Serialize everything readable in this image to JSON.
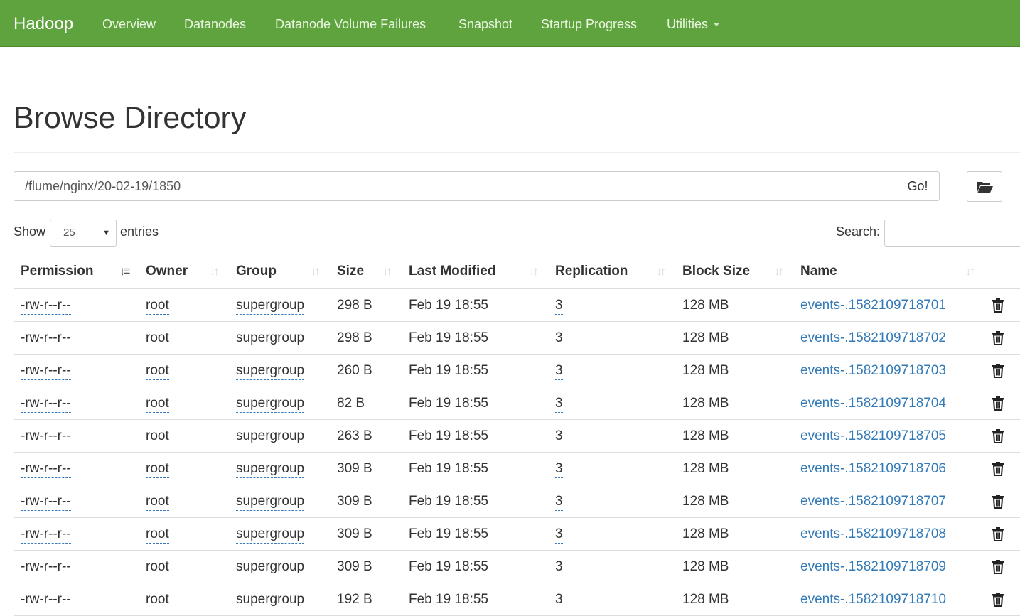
{
  "navbar": {
    "brand": "Hadoop",
    "items": [
      "Overview",
      "Datanodes",
      "Datanode Volume Failures",
      "Snapshot",
      "Startup Progress",
      "Utilities"
    ],
    "color": "#5fa33e"
  },
  "page": {
    "title": "Browse Directory"
  },
  "path_bar": {
    "value": "/flume/nginx/20-02-19/1850",
    "go_label": "Go!",
    "folder_icon": "folder-open-icon"
  },
  "controls": {
    "show_label": "Show",
    "page_length": "25",
    "entries_label": "entries",
    "search_label": "Search:",
    "search_value": ""
  },
  "table": {
    "columns": [
      "Permission",
      "Owner",
      "Group",
      "Size",
      "Last Modified",
      "Replication",
      "Block Size",
      "Name"
    ],
    "sorted_column": "Permission",
    "rows": [
      {
        "permission": "-rw-r--r--",
        "owner": "root",
        "group": "supergroup",
        "size": "298 B",
        "modified": "Feb 19 18:55",
        "replication": "3",
        "block_size": "128 MB",
        "name": "events-.1582109718701"
      },
      {
        "permission": "-rw-r--r--",
        "owner": "root",
        "group": "supergroup",
        "size": "298 B",
        "modified": "Feb 19 18:55",
        "replication": "3",
        "block_size": "128 MB",
        "name": "events-.1582109718702"
      },
      {
        "permission": "-rw-r--r--",
        "owner": "root",
        "group": "supergroup",
        "size": "260 B",
        "modified": "Feb 19 18:55",
        "replication": "3",
        "block_size": "128 MB",
        "name": "events-.1582109718703"
      },
      {
        "permission": "-rw-r--r--",
        "owner": "root",
        "group": "supergroup",
        "size": "82 B",
        "modified": "Feb 19 18:55",
        "replication": "3",
        "block_size": "128 MB",
        "name": "events-.1582109718704"
      },
      {
        "permission": "-rw-r--r--",
        "owner": "root",
        "group": "supergroup",
        "size": "263 B",
        "modified": "Feb 19 18:55",
        "replication": "3",
        "block_size": "128 MB",
        "name": "events-.1582109718705"
      },
      {
        "permission": "-rw-r--r--",
        "owner": "root",
        "group": "supergroup",
        "size": "309 B",
        "modified": "Feb 19 18:55",
        "replication": "3",
        "block_size": "128 MB",
        "name": "events-.1582109718706"
      },
      {
        "permission": "-rw-r--r--",
        "owner": "root",
        "group": "supergroup",
        "size": "309 B",
        "modified": "Feb 19 18:55",
        "replication": "3",
        "block_size": "128 MB",
        "name": "events-.1582109718707"
      },
      {
        "permission": "-rw-r--r--",
        "owner": "root",
        "group": "supergroup",
        "size": "309 B",
        "modified": "Feb 19 18:55",
        "replication": "3",
        "block_size": "128 MB",
        "name": "events-.1582109718708"
      },
      {
        "permission": "-rw-r--r--",
        "owner": "root",
        "group": "supergroup",
        "size": "309 B",
        "modified": "Feb 19 18:55",
        "replication": "3",
        "block_size": "128 MB",
        "name": "events-.1582109718709"
      },
      {
        "permission": "-rw-r--r--",
        "owner": "root",
        "group": "supergroup",
        "size": "192 B",
        "modified": "Feb 19 18:55",
        "replication": "3",
        "block_size": "128 MB",
        "name": "events-.1582109718710"
      }
    ],
    "row_action_icon": "trash-icon",
    "link_color": "#337ab7"
  }
}
